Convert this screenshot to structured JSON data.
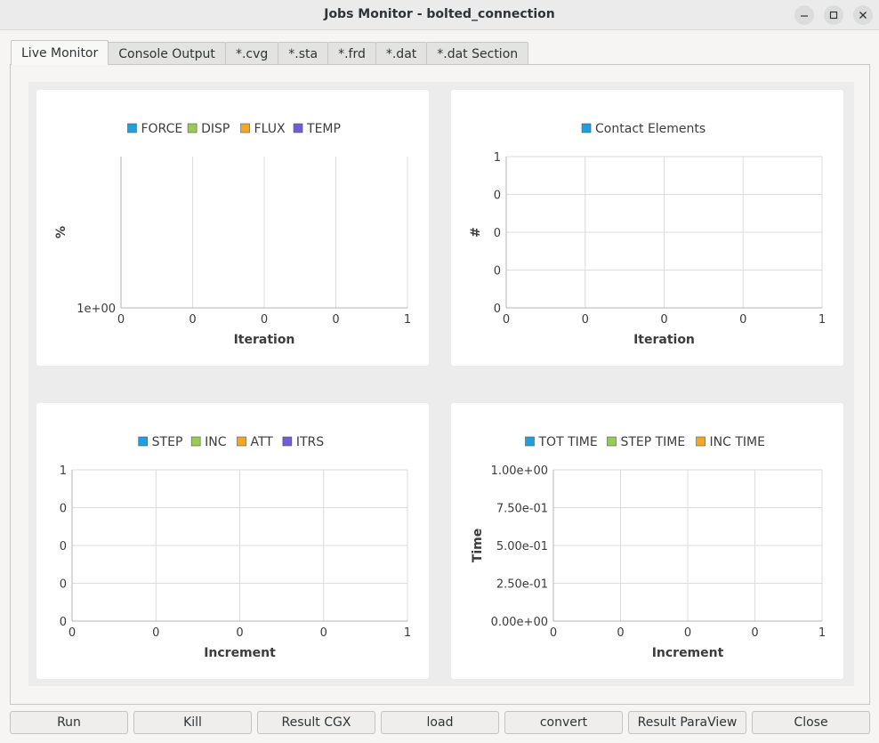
{
  "window": {
    "title": "Jobs Monitor - bolted_connection"
  },
  "tabs": [
    {
      "label": "Live Monitor",
      "active": true
    },
    {
      "label": "Console Output"
    },
    {
      "label": "*.cvg"
    },
    {
      "label": "*.sta"
    },
    {
      "label": "*.frd"
    },
    {
      "label": "*.dat"
    },
    {
      "label": "*.dat Section"
    }
  ],
  "buttons": {
    "run": "Run",
    "kill": "Kill",
    "result_cgx": "Result CGX",
    "load": "load",
    "convert": "convert",
    "result_paraview": "Result ParaView",
    "close": "Close"
  },
  "colors": {
    "series_blue": "#209fdf",
    "series_green": "#99ca53",
    "series_orange": "#f6a625",
    "series_purple": "#6d5fd5",
    "grid": "#dcdcdc",
    "axis": "#b4b4b4"
  },
  "chart_data": [
    {
      "type": "line",
      "legend": [
        "FORCE",
        "DISP",
        "FLUX",
        "TEMP"
      ],
      "xlabel": "Iteration",
      "ylabel": "%",
      "x_ticks": [
        "0",
        "0",
        "0",
        "0",
        "1"
      ],
      "y_ticks": [
        "1e+00"
      ],
      "y_scale": "log",
      "series": [
        {
          "name": "FORCE",
          "values": []
        },
        {
          "name": "DISP",
          "values": []
        },
        {
          "name": "FLUX",
          "values": []
        },
        {
          "name": "TEMP",
          "values": []
        }
      ]
    },
    {
      "type": "line",
      "legend": [
        "Contact Elements"
      ],
      "xlabel": "Iteration",
      "ylabel": "#",
      "x_ticks": [
        "0",
        "0",
        "0",
        "0",
        "1"
      ],
      "y_ticks": [
        "1",
        "0",
        "0",
        "0",
        "0"
      ],
      "series": [
        {
          "name": "Contact Elements",
          "values": []
        }
      ]
    },
    {
      "type": "line",
      "legend": [
        "STEP",
        "INC",
        "ATT",
        "ITRS"
      ],
      "xlabel": "Increment",
      "ylabel": "",
      "x_ticks": [
        "0",
        "0",
        "0",
        "0",
        "1"
      ],
      "y_ticks": [
        "1",
        "0",
        "0",
        "0",
        "0"
      ],
      "series": [
        {
          "name": "STEP",
          "values": []
        },
        {
          "name": "INC",
          "values": []
        },
        {
          "name": "ATT",
          "values": []
        },
        {
          "name": "ITRS",
          "values": []
        }
      ]
    },
    {
      "type": "line",
      "legend": [
        "TOT TIME",
        "STEP TIME",
        "INC TIME"
      ],
      "xlabel": "Increment",
      "ylabel": "Time",
      "x_ticks": [
        "0",
        "0",
        "0",
        "0",
        "1"
      ],
      "y_ticks": [
        "1.00e+00",
        "7.50e-01",
        "5.00e-01",
        "2.50e-01",
        "0.00e+00"
      ],
      "ylim": [
        0,
        1
      ],
      "series": [
        {
          "name": "TOT TIME",
          "values": []
        },
        {
          "name": "STEP TIME",
          "values": []
        },
        {
          "name": "INC TIME",
          "values": []
        }
      ]
    }
  ]
}
